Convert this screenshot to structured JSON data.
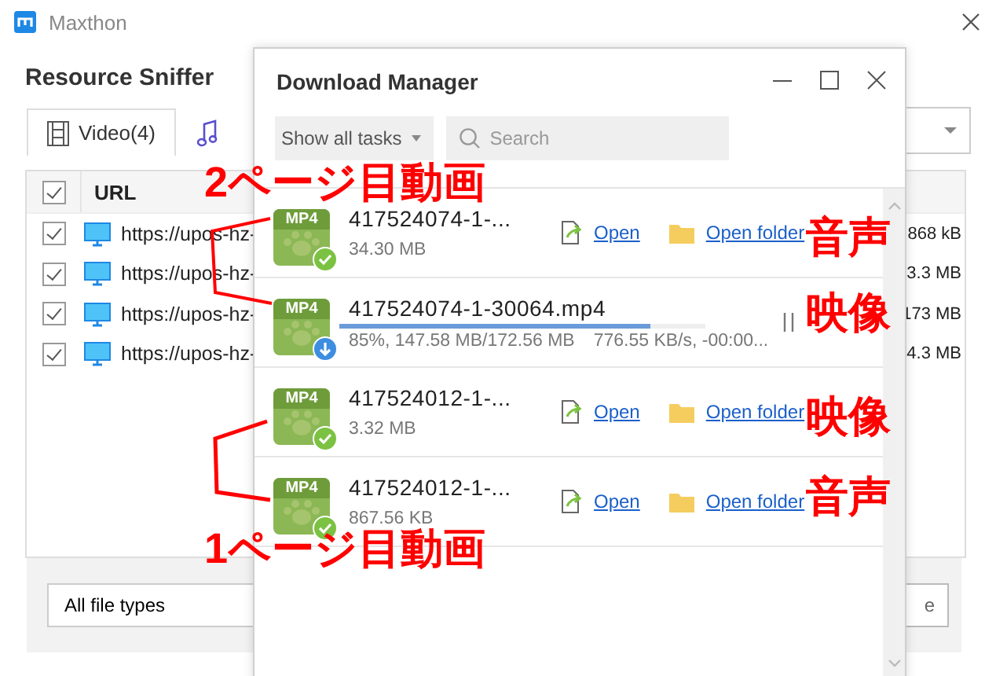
{
  "window": {
    "title": "Maxthon"
  },
  "sniffer": {
    "title": "Resource Sniffer",
    "tabs": [
      {
        "label": "Video(4)",
        "kind": "video",
        "selected": true
      },
      {
        "kind": "audio",
        "selected": false
      }
    ],
    "table": {
      "columns": [
        "URL"
      ],
      "header_checked": true,
      "rows": [
        {
          "checked": true,
          "url": "https://upos-hz-",
          "size": "868 kB"
        },
        {
          "checked": true,
          "url": "https://upos-hz-",
          "size": "3.3 MB"
        },
        {
          "checked": true,
          "url": "https://upos-hz-",
          "size": "173 MB"
        },
        {
          "checked": true,
          "url": "https://upos-hz-",
          "size": "4.3 MB"
        }
      ]
    },
    "filter": "All file types",
    "button": "e"
  },
  "download_manager": {
    "title": "Download Manager",
    "filter": "Show all tasks",
    "search": {
      "placeholder": "Search"
    },
    "tasks": [
      {
        "kind": "done",
        "badge": "MP4",
        "name": "417524074-1-...",
        "size": "34.30 MB",
        "open": "Open",
        "open_folder": "Open folder"
      },
      {
        "kind": "downloading",
        "badge": "MP4",
        "name": "417524074-1-30064.mp4",
        "level": 0.85,
        "status": "85%, 147.58 MB/172.56 MB",
        "speed": "776.55 KB/s, -00:00..."
      },
      {
        "kind": "done",
        "badge": "MP4",
        "name": "417524012-1-...",
        "size": "3.32 MB",
        "open": "Open",
        "open_folder": "Open folder"
      },
      {
        "kind": "done",
        "badge": "MP4",
        "name": "417524012-1-...",
        "size": "867.56 KB",
        "open": "Open",
        "open_folder": "Open folder"
      }
    ]
  },
  "annotations": [
    {
      "text": "2ページ目動画"
    },
    {
      "text": "音声"
    },
    {
      "text": "映像"
    },
    {
      "text": "映像"
    },
    {
      "text": "音声"
    },
    {
      "text": "1ページ目動画"
    }
  ]
}
